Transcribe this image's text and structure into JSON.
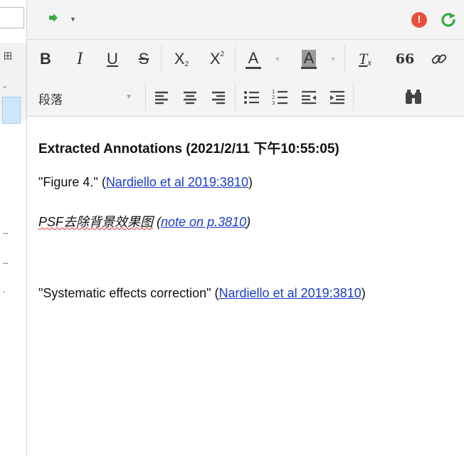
{
  "left_pane": {
    "glyph_top": "田",
    "dots": [
      "..",
      "...",
      "...",
      "."
    ]
  },
  "toolbar_top": {
    "icons": [
      "green-arrow-icon",
      "dropdown-caret-icon",
      "alert-icon",
      "refresh-icon"
    ],
    "alert_label": "!"
  },
  "format_toolbar": {
    "bold": "B",
    "italic": "I",
    "underline": "U",
    "strikethrough": "S",
    "subscript": "X",
    "subscript_mark": "2",
    "superscript": "X",
    "superscript_mark": "2",
    "text_color": "A",
    "highlight_color": "A",
    "clear_format": "T",
    "clear_mark": "x",
    "blockquote": "66",
    "link_icon": "link-icon"
  },
  "paragraph_toolbar": {
    "format_select": "段落",
    "icons": [
      "align-left-icon",
      "align-center-icon",
      "align-right-icon",
      "bullet-list-icon",
      "numbered-list-icon",
      "outdent-icon",
      "indent-icon",
      "find-icon"
    ]
  },
  "note": {
    "heading": "Extracted Annotations (2021/2/11 下午10:55:05)",
    "line1_quote": "\"Figure 4.\" (",
    "line1_link": "Nardiello et al 2019:3810",
    "line1_end": ")",
    "line2_text": "PSF去除背景效果图",
    "line2_open": " (",
    "line2_link": "note on p.3810",
    "line2_end": ")",
    "line3_quote": "\"Systematic effects correction\" (",
    "line3_link": "Nardiello et al 2019:3810",
    "line3_end": ")"
  },
  "colors": {
    "accent_green": "#3aa845",
    "alert_red": "#e8503a",
    "link_blue": "#1a3ccc"
  }
}
